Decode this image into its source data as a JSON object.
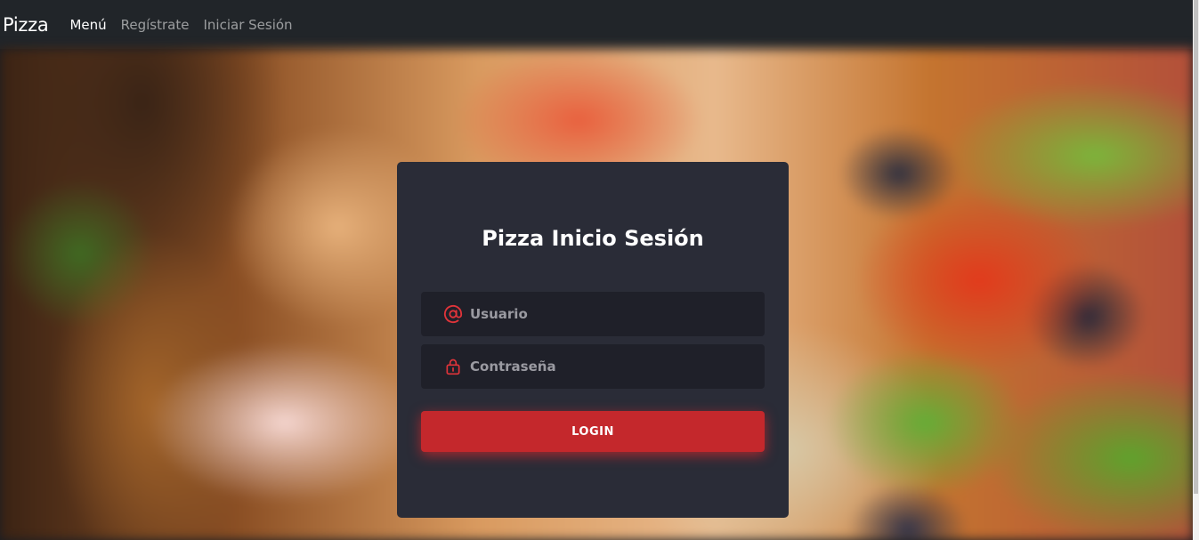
{
  "navbar": {
    "brand": "Pizza",
    "links": [
      {
        "label": "Menú",
        "active": true
      },
      {
        "label": "Regístrate",
        "active": false
      },
      {
        "label": "Iniciar Sesión",
        "active": false
      }
    ]
  },
  "login": {
    "title": "Pizza Inicio Sesión",
    "username": {
      "placeholder": "Usuario",
      "value": "",
      "icon": "at-icon"
    },
    "password": {
      "placeholder": "Contraseña",
      "value": "",
      "icon": "lock-icon"
    },
    "button_label": "LOGIN"
  },
  "colors": {
    "accent": "#c4282c",
    "card": "#2a2c37",
    "field": "#1f2029",
    "navbar": "#212529"
  }
}
